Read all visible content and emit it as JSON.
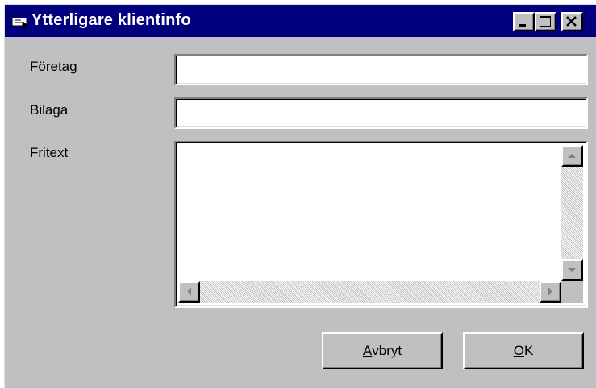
{
  "window": {
    "title": "Ytterligare klientinfo",
    "icon": "app-window-icon",
    "controls": [
      "minimize-icon",
      "maximize-icon",
      "close-icon"
    ]
  },
  "form": {
    "foretag": {
      "label": "Företag",
      "value": ""
    },
    "bilaga": {
      "label": "Bilaga",
      "value": ""
    },
    "fritext": {
      "label": "Fritext",
      "value": ""
    }
  },
  "buttons": {
    "cancel": {
      "mnemonic": "A",
      "rest": "vbryt"
    },
    "ok": {
      "mnemonic": "O",
      "rest": "K"
    }
  },
  "colors": {
    "title_bar": "#00007f",
    "face": "#c0c0c0",
    "field": "#ffffff"
  }
}
